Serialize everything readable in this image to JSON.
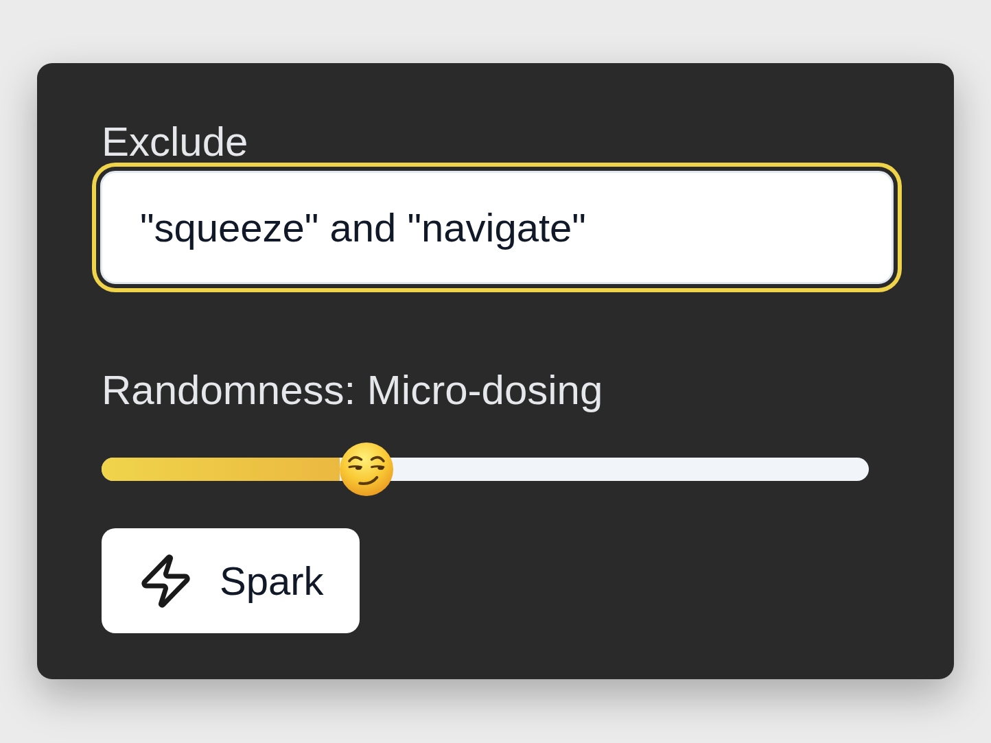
{
  "exclude": {
    "label": "Exclude",
    "value": "\"squeeze\" and \"navigate\"",
    "focused": true
  },
  "randomness": {
    "label": "Randomness: Micro-dosing",
    "level": 0.345
  },
  "spark_button": {
    "label": "Spark"
  }
}
